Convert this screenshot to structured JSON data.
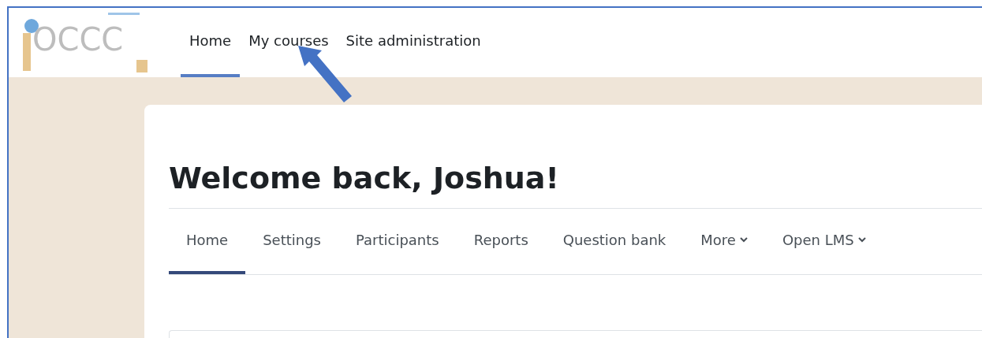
{
  "logo": {
    "text": "OCCC"
  },
  "primary_nav": [
    {
      "label": "Home",
      "selected": true
    },
    {
      "label": "My courses",
      "selected": false
    },
    {
      "label": "Site administration",
      "selected": false
    }
  ],
  "page": {
    "heading": "Welcome back, Joshua!"
  },
  "secondary_nav": [
    {
      "label": "Home",
      "selected": true,
      "kind": "link"
    },
    {
      "label": "Settings",
      "selected": false,
      "kind": "link"
    },
    {
      "label": "Participants",
      "selected": false,
      "kind": "link"
    },
    {
      "label": "Reports",
      "selected": false,
      "kind": "link"
    },
    {
      "label": "Question bank",
      "selected": false,
      "kind": "link"
    },
    {
      "label": "More",
      "selected": false,
      "kind": "dropdown"
    },
    {
      "label": "Open LMS",
      "selected": false,
      "kind": "dropdown"
    }
  ]
}
